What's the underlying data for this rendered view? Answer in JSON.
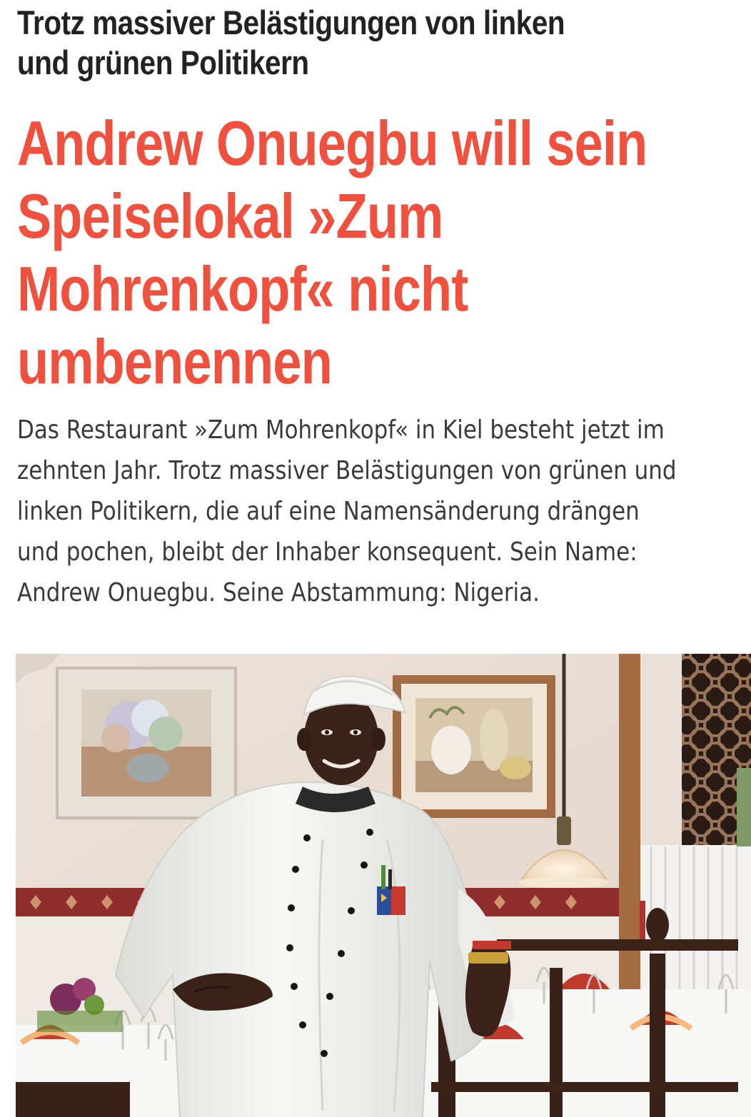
{
  "article": {
    "kicker": "Trotz massiver Belästigungen von linken\nund grünen Politikern",
    "headline_lines": [
      "Andrew Onuegbu will sein",
      "Speiselokal »Zum",
      "Mohrenkopf« nicht",
      "umbenennen"
    ],
    "lede_lines": [
      "Das Restaurant »Zum Mohrenkopf« in Kiel besteht jetzt im",
      "zehnten Jahr. Trotz massiver Belästigungen von grünen und",
      "linken Politikern, die auf eine Namensänderung drängen",
      "und pochen, bleibt der Inhaber konsequent. Sein Name:",
      "Andrew Onuegbu. Seine Abstammung: Nigeria."
    ]
  },
  "colors": {
    "headline": "#f0513f",
    "kicker": "#222222",
    "body_text": "#3a3a3a",
    "wall": "#efe6df",
    "chef_jacket": "#f4f4f2"
  },
  "icons": {
    "photo": "restaurant-chef-photo"
  }
}
